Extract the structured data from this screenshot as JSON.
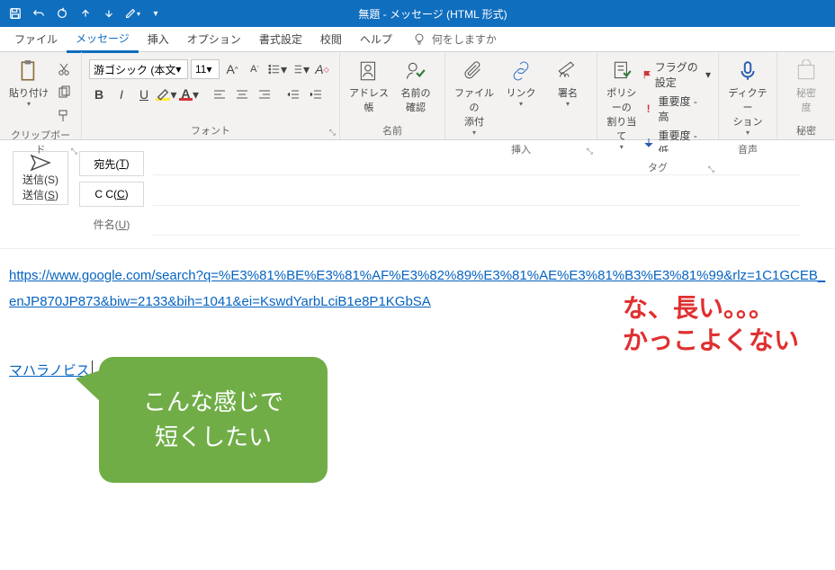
{
  "titlebar": {
    "title": "無題 - メッセージ (HTML 形式)"
  },
  "tabs": {
    "file": "ファイル",
    "message": "メッセージ",
    "insert": "挿入",
    "options": "オプション",
    "format": "書式設定",
    "review": "校閲",
    "help": "ヘルプ",
    "tellme": "何をしますか"
  },
  "ribbon": {
    "clipboard": {
      "paste": "貼り付け",
      "label": "クリップボード"
    },
    "font": {
      "name": "游ゴシック (本文",
      "size": "11",
      "label": "フォント"
    },
    "paragraph_label": "",
    "names": {
      "address": "アドレス帳",
      "check": "名前の\n確認",
      "label": "名前"
    },
    "include": {
      "attach": "ファイルの\n添付",
      "link": "リンク",
      "signature": "署名",
      "label": "挿入"
    },
    "tags": {
      "policy": "ポリシーの\n割り当て",
      "flag": "フラグの設定",
      "high": "重要度 - 高",
      "low": "重要度 - 低",
      "label": "タグ"
    },
    "voice": {
      "dictate": "ディクテー\nション",
      "label": "音声"
    },
    "secrecy": {
      "btn": "秘密\n度",
      "label": "秘密"
    }
  },
  "compose": {
    "send": "送信(S)",
    "to": "宛先(T)",
    "cc": "C C(C)",
    "subject": "件名(U)",
    "to_value": "",
    "cc_value": "",
    "subject_value": ""
  },
  "body": {
    "long_url": "https://www.google.com/search?q=%E3%81%BE%E3%81%AF%E3%82%89%E3%81%AE%E3%81%B3%E3%81%99&rlz=1C1GCEB_enJP870JP873&biw=2133&bih=1041&ei=KswdYarbLciB1e8P1KGbSA",
    "short_link": "マハラノビス",
    "annot1": "な、長い。。。",
    "annot2": "かっこよくない",
    "callout1": "こんな感じで",
    "callout2": "短くしたい"
  }
}
